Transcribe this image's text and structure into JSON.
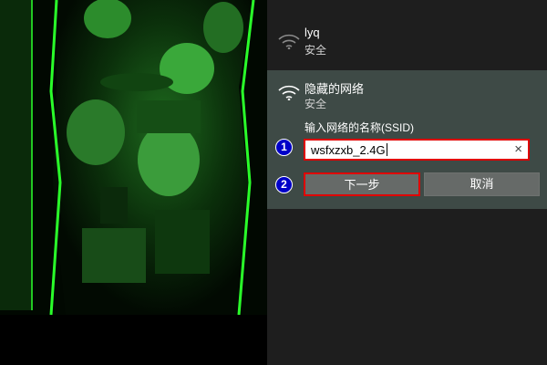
{
  "networks": [
    {
      "ssid": "lyq",
      "security": "安全",
      "icon": "wifi-icon",
      "selected": false
    },
    {
      "ssid": "隐藏的网络",
      "security": "安全",
      "icon": "wifi-icon",
      "selected": true
    }
  ],
  "connect_form": {
    "ssid_label": "输入网络的名称(SSID)",
    "ssid_value": "wsfxzxb_2.4G",
    "clear_icon": "×",
    "next_button": "下一步",
    "cancel_button": "取消"
  },
  "annotations": [
    "1",
    "2"
  ],
  "colors": {
    "panel_bg": "#1e1e1e",
    "selected_bg": "#3e4a46",
    "button_bg": "#666a68",
    "highlight_border": "#e00000",
    "badge_bg": "#0000c8",
    "wallpaper_tint": "#1fd81f"
  }
}
